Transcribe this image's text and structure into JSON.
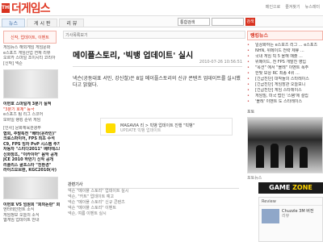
{
  "site": {
    "logo_text": "더게임스",
    "logo_mark": "THE"
  },
  "header": {
    "util_links": [
      "메인으로",
      "즐겨찾기",
      "뉴스레터"
    ]
  },
  "nav": {
    "tabs": [
      "뉴스",
      "게 시 판",
      "리 뷰"
    ],
    "search": {
      "select_value": "통합검색",
      "placeholder": ""
    },
    "search_button": "검색"
  },
  "left": {
    "menu_label": "신작, 업데이트, 이벤트",
    "lines": [
      "게임뉴스 해외게임 게임문화",
      "e스포츠 게임산업 연재 리뷰",
      "오르카 스마일 조이시티 코리아",
      "[신작] 넥슨",
      "",
      "이번호 스마일게 3분기 실적",
      "\"3분기 호재\" 등극",
      "e스포츠 팀 리그 스코어",
      "모바일 랭킹 순위 게임",
      "",
      "[인사] 문화체육관광부",
      "협회, 주말특전 \"베타(온라인)\"",
      "크로스파이어, FPS 최초 수석",
      "C9, FPS 빙자 PvP 시스템 추가",
      "자동차 \"스티다2011\" 베타테스트",
      "신화창조, \"이카이아\" 음악 공개",
      "JCE 2010 하반기 신작 공개",
      "리플리스 골프스타 \"친환경\"",
      "라이즈오브판, KGC2010(사)"
    ],
    "bottom_lines": [
      "이번호 VS 임원회 \"회의논란\" 회",
      "엔터테인먼트 소식",
      "게임정보 오늘의 소식",
      "웹게임 업데이트 안내"
    ]
  },
  "article": {
    "breadcrumb": "기사목록보기",
    "title": "메이플스토리, '빅뱅 업데이트' 실시",
    "date": "2010-07-26 10:56:51",
    "body": "넥슨(공동대표 서민, 강신철)은 8일 메이플스토리의 신규 콘텐츠 업데이트를 실시했다고 밝혔다.",
    "media_label": "MAGAVIA 리 > 빅뱅 업데이트 진행 \"빅뱅\"",
    "media_sub": "UPDATE 빅뱅 업데이트"
  },
  "related": {
    "header": "관련기사",
    "items": [
      "넥슨 \"메이플 스토리\" 업데이트 실시",
      "넥슨, \"카트\" 업데이트 예고",
      "넥슨 \"메이플 스토리\" 신규 콘텐츠",
      "넥슨 \"메이플 스토리\" 이벤트",
      "넥슨, 여름 이벤트 실시"
    ]
  },
  "right": {
    "panel_title": "랭킹뉴스",
    "rank_items": [
      "일상화하는 e스포츠 리그 ... e스포츠",
      "NHN, 위메이드 전략 제휴 ...",
      "국내 게임 빅 5 올해 매출 ...",
      "위메이드, 전 FPS 개발진 영입",
      "\"옥션\" 에서 \"블레\" 이벤트 폭주",
      "한빛 보상 RC 최종 4위 ...",
      "[긴급진단] 대작들의 스타레이스",
      "[긴급진단] 게임장관 오늘보니",
      "[긴급진단] 게임 스타레이스",
      "게임빌, 미국 법인 '스탬'에 설립",
      "'블레' 이벤트 도 스타레이스"
    ],
    "photo_header": "포토",
    "photo_caption": "포토뉴스"
  },
  "banner": {
    "game": "GAME",
    "zone": "ZONE"
  },
  "review": {
    "header": "Review",
    "title": "Chuzzle 3M 버전",
    "sub": "리뷰"
  },
  "colors": {
    "brand_red": "#d8321f",
    "nav_active": "#2a5d9a",
    "banner_bg": "#1b1b1b",
    "banner_accent": "#ffd400"
  }
}
